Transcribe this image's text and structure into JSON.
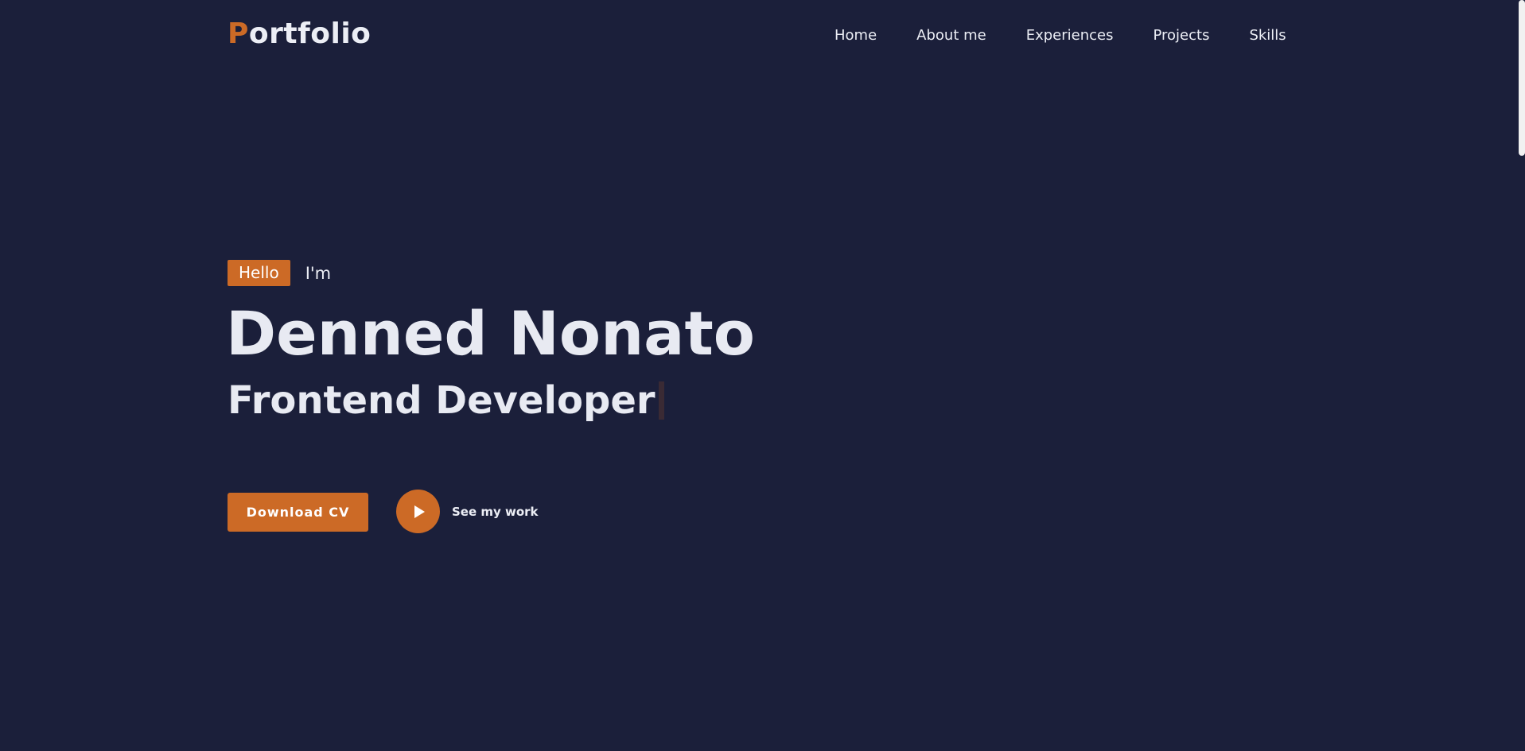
{
  "header": {
    "logo_accent": "P",
    "logo_rest": "ortfolio",
    "nav": [
      {
        "label": "Home"
      },
      {
        "label": "About me"
      },
      {
        "label": "Experiences"
      },
      {
        "label": "Projects"
      },
      {
        "label": "Skills"
      }
    ]
  },
  "hero": {
    "hello_badge": "Hello",
    "im_text": "I'm",
    "name": "Denned Nonato",
    "role": "Frontend Developer",
    "download_button": "Download CV",
    "see_work_label": "See my work",
    "play_icon": "play-icon"
  },
  "colors": {
    "background": "#1b1f3a",
    "accent": "#cc6a26",
    "text": "#eceef5"
  }
}
